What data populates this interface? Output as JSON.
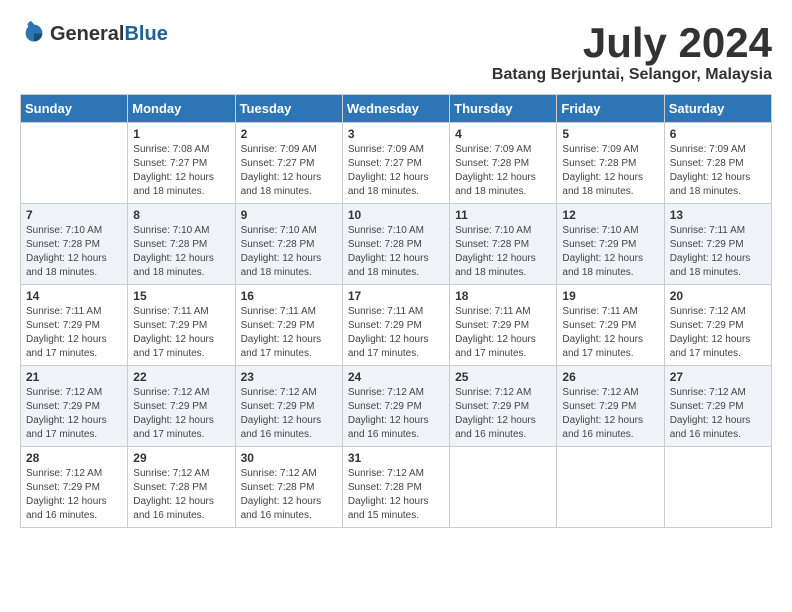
{
  "header": {
    "logo_general": "General",
    "logo_blue": "Blue",
    "month_title": "July 2024",
    "location": "Batang Berjuntai, Selangor, Malaysia"
  },
  "days_of_week": [
    "Sunday",
    "Monday",
    "Tuesday",
    "Wednesday",
    "Thursday",
    "Friday",
    "Saturday"
  ],
  "weeks": [
    [
      {
        "day": "",
        "info": ""
      },
      {
        "day": "1",
        "info": "Sunrise: 7:08 AM\nSunset: 7:27 PM\nDaylight: 12 hours and 18 minutes."
      },
      {
        "day": "2",
        "info": "Sunrise: 7:09 AM\nSunset: 7:27 PM\nDaylight: 12 hours and 18 minutes."
      },
      {
        "day": "3",
        "info": "Sunrise: 7:09 AM\nSunset: 7:27 PM\nDaylight: 12 hours and 18 minutes."
      },
      {
        "day": "4",
        "info": "Sunrise: 7:09 AM\nSunset: 7:28 PM\nDaylight: 12 hours and 18 minutes."
      },
      {
        "day": "5",
        "info": "Sunrise: 7:09 AM\nSunset: 7:28 PM\nDaylight: 12 hours and 18 minutes."
      },
      {
        "day": "6",
        "info": "Sunrise: 7:09 AM\nSunset: 7:28 PM\nDaylight: 12 hours and 18 minutes."
      }
    ],
    [
      {
        "day": "7",
        "info": "Sunrise: 7:10 AM\nSunset: 7:28 PM\nDaylight: 12 hours and 18 minutes."
      },
      {
        "day": "8",
        "info": "Sunrise: 7:10 AM\nSunset: 7:28 PM\nDaylight: 12 hours and 18 minutes."
      },
      {
        "day": "9",
        "info": "Sunrise: 7:10 AM\nSunset: 7:28 PM\nDaylight: 12 hours and 18 minutes."
      },
      {
        "day": "10",
        "info": "Sunrise: 7:10 AM\nSunset: 7:28 PM\nDaylight: 12 hours and 18 minutes."
      },
      {
        "day": "11",
        "info": "Sunrise: 7:10 AM\nSunset: 7:28 PM\nDaylight: 12 hours and 18 minutes."
      },
      {
        "day": "12",
        "info": "Sunrise: 7:10 AM\nSunset: 7:29 PM\nDaylight: 12 hours and 18 minutes."
      },
      {
        "day": "13",
        "info": "Sunrise: 7:11 AM\nSunset: 7:29 PM\nDaylight: 12 hours and 18 minutes."
      }
    ],
    [
      {
        "day": "14",
        "info": "Sunrise: 7:11 AM\nSunset: 7:29 PM\nDaylight: 12 hours and 17 minutes."
      },
      {
        "day": "15",
        "info": "Sunrise: 7:11 AM\nSunset: 7:29 PM\nDaylight: 12 hours and 17 minutes."
      },
      {
        "day": "16",
        "info": "Sunrise: 7:11 AM\nSunset: 7:29 PM\nDaylight: 12 hours and 17 minutes."
      },
      {
        "day": "17",
        "info": "Sunrise: 7:11 AM\nSunset: 7:29 PM\nDaylight: 12 hours and 17 minutes."
      },
      {
        "day": "18",
        "info": "Sunrise: 7:11 AM\nSunset: 7:29 PM\nDaylight: 12 hours and 17 minutes."
      },
      {
        "day": "19",
        "info": "Sunrise: 7:11 AM\nSunset: 7:29 PM\nDaylight: 12 hours and 17 minutes."
      },
      {
        "day": "20",
        "info": "Sunrise: 7:12 AM\nSunset: 7:29 PM\nDaylight: 12 hours and 17 minutes."
      }
    ],
    [
      {
        "day": "21",
        "info": "Sunrise: 7:12 AM\nSunset: 7:29 PM\nDaylight: 12 hours and 17 minutes."
      },
      {
        "day": "22",
        "info": "Sunrise: 7:12 AM\nSunset: 7:29 PM\nDaylight: 12 hours and 17 minutes."
      },
      {
        "day": "23",
        "info": "Sunrise: 7:12 AM\nSunset: 7:29 PM\nDaylight: 12 hours and 16 minutes."
      },
      {
        "day": "24",
        "info": "Sunrise: 7:12 AM\nSunset: 7:29 PM\nDaylight: 12 hours and 16 minutes."
      },
      {
        "day": "25",
        "info": "Sunrise: 7:12 AM\nSunset: 7:29 PM\nDaylight: 12 hours and 16 minutes."
      },
      {
        "day": "26",
        "info": "Sunrise: 7:12 AM\nSunset: 7:29 PM\nDaylight: 12 hours and 16 minutes."
      },
      {
        "day": "27",
        "info": "Sunrise: 7:12 AM\nSunset: 7:29 PM\nDaylight: 12 hours and 16 minutes."
      }
    ],
    [
      {
        "day": "28",
        "info": "Sunrise: 7:12 AM\nSunset: 7:29 PM\nDaylight: 12 hours and 16 minutes."
      },
      {
        "day": "29",
        "info": "Sunrise: 7:12 AM\nSunset: 7:28 PM\nDaylight: 12 hours and 16 minutes."
      },
      {
        "day": "30",
        "info": "Sunrise: 7:12 AM\nSunset: 7:28 PM\nDaylight: 12 hours and 16 minutes."
      },
      {
        "day": "31",
        "info": "Sunrise: 7:12 AM\nSunset: 7:28 PM\nDaylight: 12 hours and 15 minutes."
      },
      {
        "day": "",
        "info": ""
      },
      {
        "day": "",
        "info": ""
      },
      {
        "day": "",
        "info": ""
      }
    ]
  ]
}
